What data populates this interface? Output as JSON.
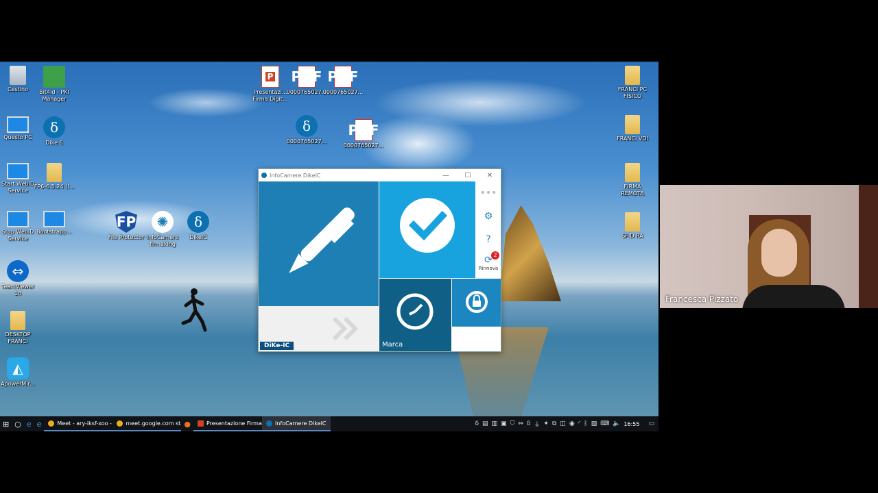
{
  "desktop": {
    "icons": [
      {
        "label": "Cestino"
      },
      {
        "label": "Bit4id - PKI Manager"
      },
      {
        "label": "Questo PC"
      },
      {
        "label": "Dike 6"
      },
      {
        "label": "Start WebID Service"
      },
      {
        "label": "FP6-6.5.24 (I..."
      },
      {
        "label": "Stop WebID Service"
      },
      {
        "label": "Bootstrapp..."
      },
      {
        "label": "File Protector"
      },
      {
        "label": "InfoCamere firmaking"
      },
      {
        "label": "DikeIC"
      },
      {
        "label": "TeamViewer 14"
      },
      {
        "label": "DESKTOP FRANCI"
      },
      {
        "label": "ApowerMir..."
      },
      {
        "label": "Presentazi... Firma Digit..."
      },
      {
        "label": "0000765027..."
      },
      {
        "label": "0000765027..."
      },
      {
        "label": "0000765027..."
      },
      {
        "label": "0000765027..."
      },
      {
        "label": "FRANCI PC FISICO"
      },
      {
        "label": "FRANCI VDI"
      },
      {
        "label": "FIRMA REMOTA"
      },
      {
        "label": "SPID RA"
      }
    ],
    "pdf_text": "PDF"
  },
  "app": {
    "title": "InfoCamere DikeIC",
    "dike_label": "DiKe-IC",
    "marca_label": "Marca",
    "rinnova_label": "Rinnova",
    "badge_count": "2",
    "more_icon": "•••"
  },
  "taskbar": {
    "tasks": [
      {
        "label": "Meet - ary-iksf-xoo - ...",
        "color": "#e8b020"
      },
      {
        "label": "meet.google.com sta ...",
        "color": "#e8b020"
      },
      {
        "label": "Presentazione Firma ...",
        "color": "#d04423"
      },
      {
        "label": "InfoCamere DikeIC",
        "color": "#0d70b0"
      }
    ],
    "time": "16:55"
  },
  "video": {
    "participant_name": "Francesca Pizzato"
  }
}
